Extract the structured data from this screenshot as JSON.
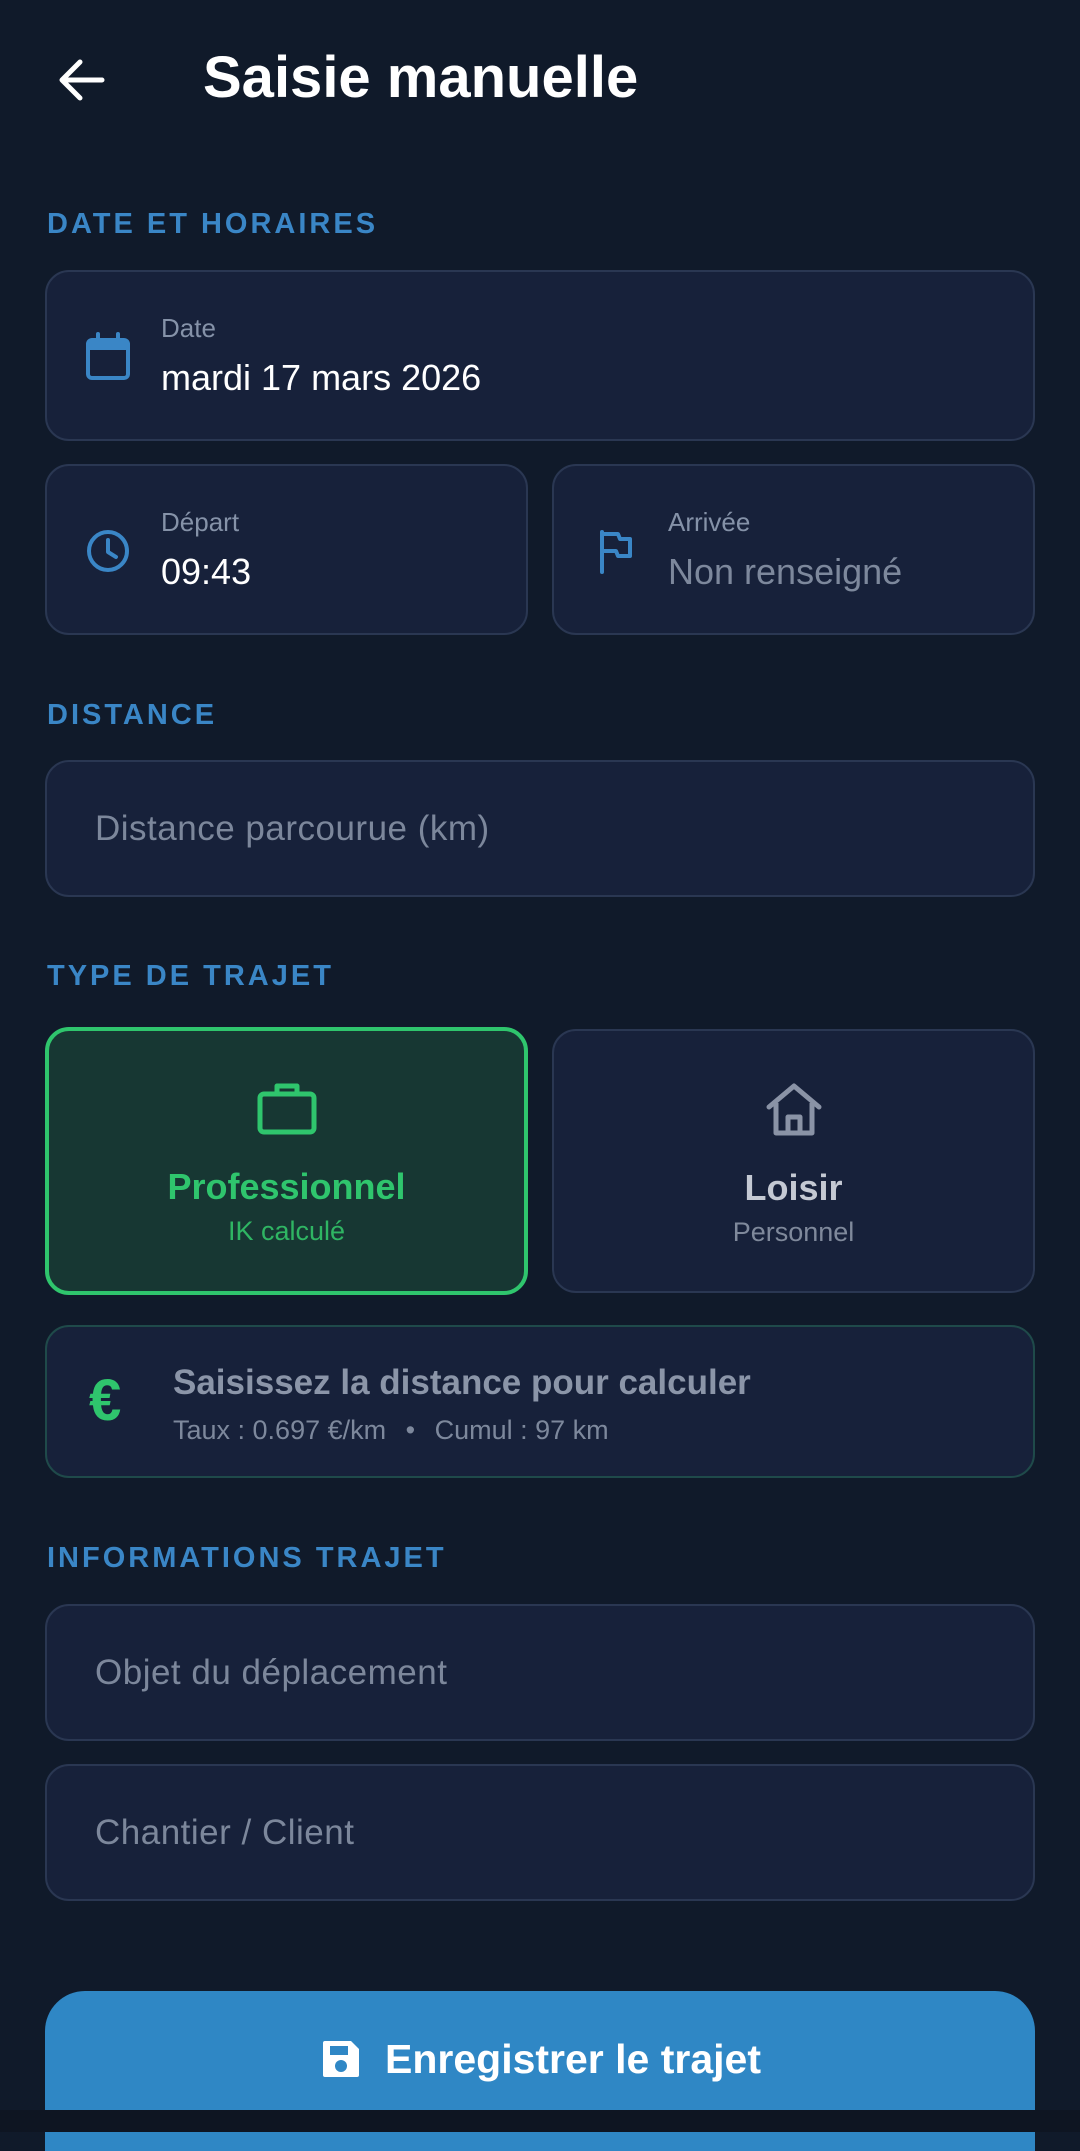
{
  "header": {
    "title": "Saisie manuelle",
    "back_icon": "arrow-left-icon"
  },
  "sections": {
    "date_time": "DATE ET HORAIRES",
    "distance": "DISTANCE",
    "trip_type": "TYPE DE TRAJET",
    "trip_info": "INFORMATIONS TRAJET"
  },
  "date_field": {
    "label": "Date",
    "value": "mardi 17 mars 2026",
    "icon": "calendar-icon"
  },
  "departure_field": {
    "label": "Départ",
    "value": "09:43",
    "icon": "clock-icon"
  },
  "arrival_field": {
    "label": "Arrivée",
    "value": "Non renseigné",
    "icon": "flag-icon"
  },
  "distance_input": {
    "placeholder": "Distance parcourue (km)",
    "value": ""
  },
  "trip_types": {
    "professional": {
      "title": "Professionnel",
      "subtitle": "IK calculé",
      "icon": "briefcase-icon",
      "selected": true
    },
    "leisure": {
      "title": "Loisir",
      "subtitle": "Personnel",
      "icon": "home-icon",
      "selected": false
    }
  },
  "ik_info": {
    "icon": "euro-icon",
    "title": "Saisissez la distance pour calculer",
    "rate": "Taux : 0.697 €/km",
    "separator": "•",
    "cumulative": "Cumul : 97 km"
  },
  "purpose_input": {
    "placeholder": "Objet du déplacement",
    "value": ""
  },
  "site_input": {
    "placeholder": "Chantier / Client",
    "value": ""
  },
  "save_button": {
    "label": "Enregistrer le trajet",
    "icon": "save-icon"
  },
  "colors": {
    "background": "#101a2a",
    "card": "#17213a",
    "accent_blue": "#3a86c6",
    "accent_green": "#2fc56d",
    "button": "#2f87c5"
  }
}
